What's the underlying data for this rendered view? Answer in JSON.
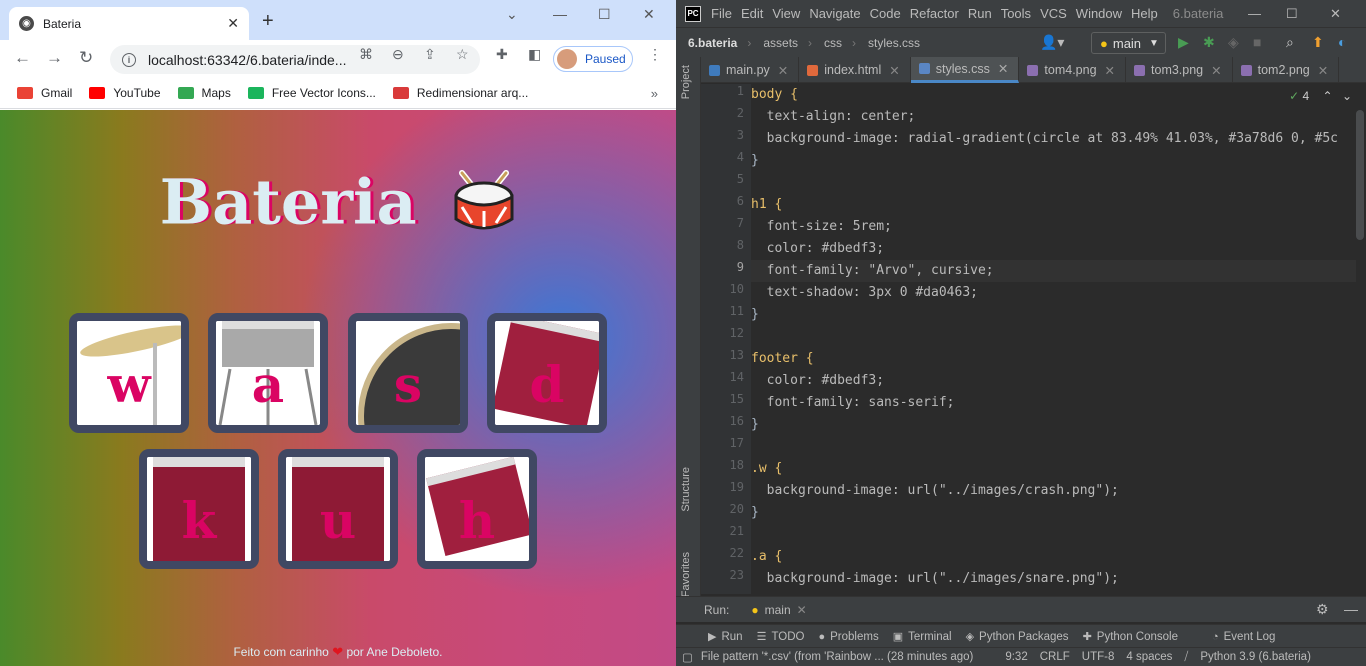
{
  "browser": {
    "tab_title": "Bateria",
    "url": "localhost:63342/6.bateria/inde...",
    "profile_status": "Paused",
    "bookmarks": [
      {
        "label": "Gmail",
        "icon": "gmail-icon",
        "color": "#ea4335"
      },
      {
        "label": "YouTube",
        "icon": "youtube-icon",
        "color": "#ff0000"
      },
      {
        "label": "Maps",
        "icon": "maps-icon",
        "color": "#34a853"
      },
      {
        "label": "Free Vector Icons...",
        "icon": "freepik-icon",
        "color": "#1bb55c"
      },
      {
        "label": "Redimensionar arq...",
        "icon": "resize-icon",
        "color": "#d93a3a"
      }
    ]
  },
  "page": {
    "title": "Bateria",
    "keys_row1": [
      "w",
      "a",
      "s",
      "d"
    ],
    "keys_row2": [
      "k",
      "u",
      "h"
    ],
    "footer_before": "Feito com carinho",
    "footer_after": "por Ane Deboleto.",
    "colors": {
      "title": "#dbedf3",
      "shadow": "#da0463",
      "key_border": "#404863"
    }
  },
  "ide": {
    "menus": [
      "File",
      "Edit",
      "View",
      "Navigate",
      "Code",
      "Refactor",
      "Run",
      "Tools",
      "VCS",
      "Window",
      "Help"
    ],
    "project_label": "6.bateria",
    "breadcrumbs": [
      "6.bateria",
      "assets",
      "css",
      "styles.css"
    ],
    "branch": "main",
    "tabs": [
      "main.py",
      "index.html",
      "styles.css",
      "tom4.png",
      "tom3.png",
      "tom2.png"
    ],
    "active_tab": "styles.css",
    "inspection_count": "4",
    "side_tools": {
      "project": "Project",
      "structure": "Structure",
      "favorites": "Favorites"
    },
    "line_numbers": [
      "1",
      "2",
      "3",
      "4",
      "5",
      "6",
      "7",
      "8",
      "9",
      "10",
      "11",
      "12",
      "13",
      "14",
      "15",
      "16",
      "17",
      "18",
      "19",
      "20",
      "21",
      "22",
      "23"
    ],
    "code_lines": [
      "body {",
      "  text-align: center;",
      "  background-image: radial-gradient(circle at 83.49% 41.03%, #3a78d6 0, #5c",
      "}",
      "",
      "h1 {",
      "  font-size: 5rem;",
      "  color: #dbedf3;",
      "  font-family: \"Arvo\", cursive;",
      "  text-shadow: 3px 0 #da0463;",
      "}",
      "",
      "footer {",
      "  color: #dbedf3;",
      "  font-family: sans-serif;",
      "}",
      "",
      ".w {",
      "  background-image: url(\"../images/crash.png\");",
      "}",
      "",
      ".a {",
      "  background-image: url(\"../images/snare.png\");"
    ],
    "run_label": "Run:",
    "run_config": "main",
    "bottom_tools": [
      "Run",
      "TODO",
      "Problems",
      "Terminal",
      "Python Packages",
      "Python Console",
      "Event Log"
    ],
    "status": {
      "message": "File pattern '*.csv' (from 'Rainbow ... (28 minutes ago)",
      "position": "9:32",
      "line_sep": "CRLF",
      "encoding": "UTF-8",
      "indent": "4 spaces",
      "interpreter": "Python 3.9 (6.bateria)"
    }
  }
}
